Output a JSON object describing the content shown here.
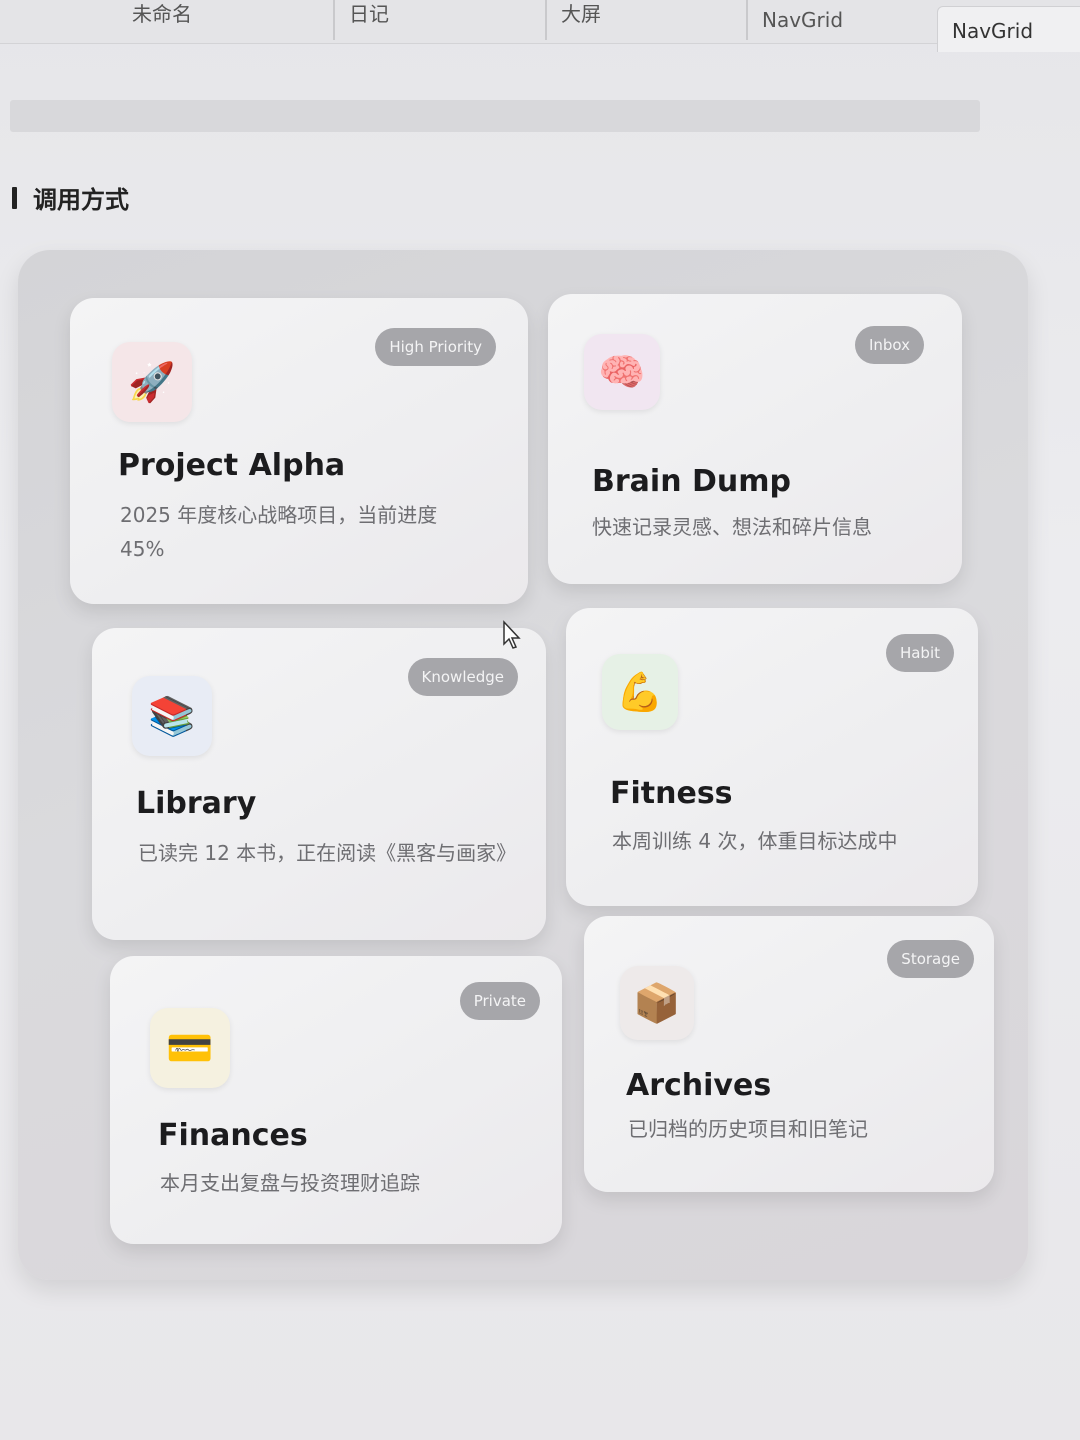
{
  "tabs": [
    {
      "label": "未命名"
    },
    {
      "label": "日记"
    },
    {
      "label": "大屏"
    },
    {
      "label": "NavGrid"
    },
    {
      "label": "NavGrid"
    }
  ],
  "section": {
    "title": "调用方式"
  },
  "cards": [
    {
      "icon": "rocket-icon",
      "emoji": "🚀",
      "badge": "High Priority",
      "title": "Project Alpha",
      "desc": "2025 年度核心战略项目，当前进度 45%",
      "icon_bg": "#f5e6e8"
    },
    {
      "icon": "brain-icon",
      "emoji": "🧠",
      "badge": "Inbox",
      "title": "Brain Dump",
      "desc": "快速记录灵感、想法和碎片信息",
      "icon_bg": "#f1e6f1"
    },
    {
      "icon": "books-icon",
      "emoji": "📚",
      "badge": "Knowledge",
      "title": "Library",
      "desc": "已读完 12 本书，正在阅读《黑客与画家》",
      "icon_bg": "#e8ecf5"
    },
    {
      "icon": "flexed-biceps-icon",
      "emoji": "💪",
      "badge": "Habit",
      "title": "Fitness",
      "desc": "本周训练 4 次，体重目标达成中",
      "icon_bg": "#e6f1e6"
    },
    {
      "icon": "credit-card-icon",
      "emoji": "💳",
      "badge": "Private",
      "title": "Finances",
      "desc": "本月支出复盘与投资理财追踪",
      "icon_bg": "#f5f1e0"
    },
    {
      "icon": "package-icon",
      "emoji": "📦",
      "badge": "Storage",
      "title": "Archives",
      "desc": "已归档的历史项目和旧笔记",
      "icon_bg": "#eeeaea"
    }
  ]
}
